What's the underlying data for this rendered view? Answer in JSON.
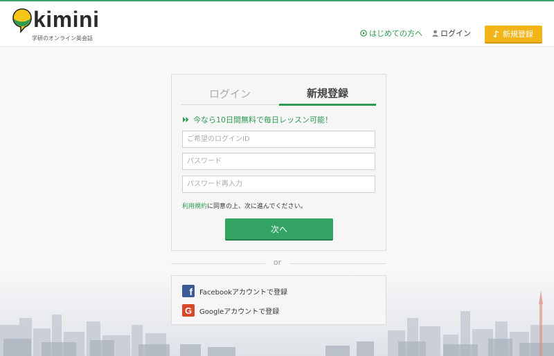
{
  "header": {
    "logo_text": "kimini",
    "tagline": "学研のオンライン英会話",
    "nav_first": "はじめての方へ",
    "nav_login": "ログイン",
    "signup_button": "新規登録",
    "icons": [
      "play-circle-icon",
      "person-icon",
      "music-note-icon"
    ]
  },
  "form": {
    "tabs": [
      {
        "label": "ログイン",
        "active": false
      },
      {
        "label": "新規登録",
        "active": true
      }
    ],
    "promo": "今なら10日間無料で毎日レッスン可能！",
    "login_id": {
      "value": "",
      "placeholder": "ご希望のログインID"
    },
    "password": {
      "value": "",
      "placeholder": "パスワード"
    },
    "password_confirm": {
      "value": "",
      "placeholder": "パスワード再入力"
    },
    "terms_link": "利用規約",
    "terms_text": "に同意の上、次に進んでください。",
    "next_button": "次へ"
  },
  "divider": {
    "text": "or"
  },
  "social": {
    "facebook": "Facebookアカウントで登録",
    "google": "Googleアカウントで登録"
  },
  "colors": {
    "brand_green": "#34a465",
    "accent_yellow": "#f3b418",
    "facebook_blue": "#3b5a98",
    "google_red": "#d9472b"
  }
}
